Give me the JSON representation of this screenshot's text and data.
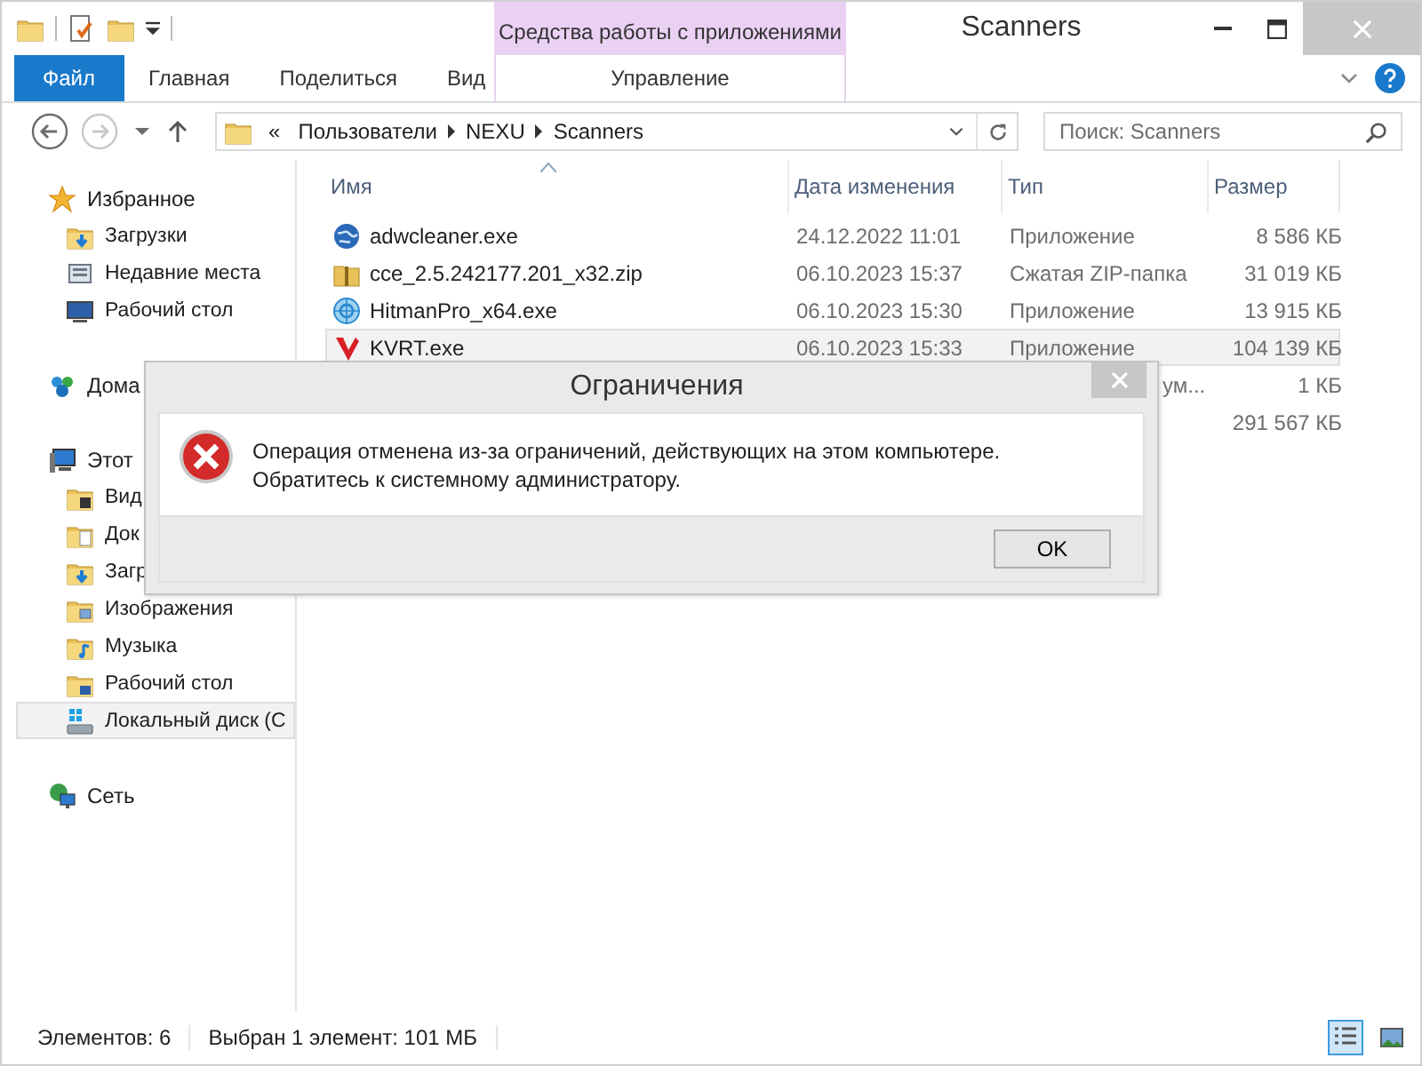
{
  "window": {
    "title": "Scanners",
    "context_tab": "Средства работы с приложениями"
  },
  "ribbon": {
    "tabs": [
      {
        "label": "Файл",
        "kind": "file",
        "selected": false
      },
      {
        "label": "Главная",
        "kind": "tab",
        "selected": false
      },
      {
        "label": "Поделиться",
        "kind": "tab",
        "selected": false
      },
      {
        "label": "Вид",
        "kind": "tab",
        "selected": false
      },
      {
        "label": "Управление",
        "kind": "context",
        "selected": false
      }
    ]
  },
  "address": {
    "overflow": "«",
    "path": [
      "Пользователи",
      "NEXU",
      "Scanners"
    ],
    "search_placeholder": "Поиск: Scanners"
  },
  "sidebar": {
    "groups": [
      {
        "label": "Избранное",
        "children": [
          {
            "label": "Загрузки",
            "selected": false
          },
          {
            "label": "Недавние места",
            "selected": false
          },
          {
            "label": "Рабочий стол",
            "selected": false
          }
        ]
      },
      {
        "label": "Дома"
      },
      {
        "label": "Этот",
        "children": [
          {
            "label": "Вид",
            "selected": false
          },
          {
            "label": "Док",
            "selected": false
          },
          {
            "label": "Загр",
            "selected": false
          },
          {
            "label": "Изображения",
            "selected": false
          },
          {
            "label": "Музыка",
            "selected": false
          },
          {
            "label": "Рабочий стол",
            "selected": false
          },
          {
            "label": "Локальный диск (С",
            "selected": true
          }
        ]
      },
      {
        "label": "Сеть"
      }
    ]
  },
  "table": {
    "columns": [
      "Имя",
      "Дата изменения",
      "Тип",
      "Размер"
    ],
    "rows": [
      {
        "name": "adwcleaner.exe",
        "date": "24.12.2022 11:01",
        "type": "Приложение",
        "size": "8 586 КБ",
        "selected": false
      },
      {
        "name": "cce_2.5.242177.201_x32.zip",
        "date": "06.10.2023 15:37",
        "type": "Сжатая ZIP-папка",
        "size": "31 019 КБ",
        "selected": false
      },
      {
        "name": "HitmanPro_x64.exe",
        "date": "06.10.2023 15:30",
        "type": "Приложение",
        "size": "13 915 КБ",
        "selected": false
      },
      {
        "name": "KVRT.exe",
        "date": "06.10.2023 15:33",
        "type": "Приложение",
        "size": "104 139 КБ",
        "selected": true
      },
      {
        "type": "ум...",
        "size": "1 КБ",
        "selected": false
      },
      {
        "size": "291 567 КБ",
        "selected": false
      }
    ]
  },
  "status_bar": {
    "count": "Элементов: 6",
    "selection": "Выбран 1 элемент: 101 МБ",
    "views": [
      {
        "kind": "details",
        "selected": true
      },
      {
        "kind": "tiles",
        "selected": false
      }
    ]
  },
  "dialog": {
    "title": "Ограничения",
    "message": "Операция отменена из-за ограничений, действующих на этом компьютере. Обратитесь к системному администратору.",
    "button": "OK"
  }
}
